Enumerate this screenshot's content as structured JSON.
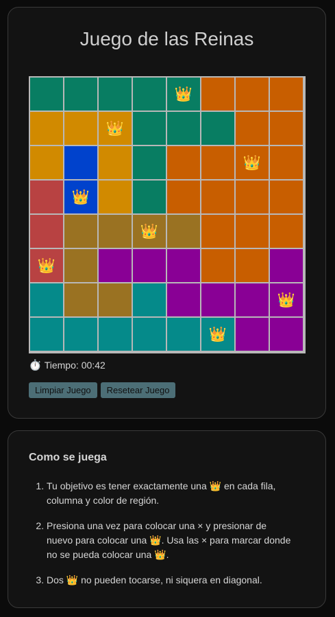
{
  "game": {
    "title": "Juego de las Reinas",
    "timer_icon": "⏱️",
    "timer_label": "Tiempo:",
    "timer_value": "00:42",
    "clear_button": "Limpiar Juego",
    "reset_button": "Resetear Juego"
  },
  "colors": {
    "G": "#087d62",
    "O": "#c85e00",
    "Y": "#d18a00",
    "B": "#0042cc",
    "R": "#b84242",
    "K": "#9a7222",
    "P": "#890095",
    "T": "#058a8a"
  },
  "board": {
    "queen_symbol": "👑",
    "rows": [
      "GGGGGOOO",
      "YYYGGGOO",
      "YBYGOOOO",
      "RBYGOOOO",
      "RKKKKOOO",
      "RKPPPOOP",
      "TKKTPPPP",
      "TTTTTTPP"
    ],
    "queens": [
      [
        0,
        4
      ],
      [
        1,
        2
      ],
      [
        2,
        6
      ],
      [
        3,
        1
      ],
      [
        4,
        3
      ],
      [
        5,
        0
      ],
      [
        6,
        7
      ],
      [
        7,
        5
      ]
    ]
  },
  "rules": {
    "title": "Como se juega",
    "items": [
      "Tu objetivo es tener exactamente una 👑 en cada fila, columna y color de región.",
      "Presiona una vez para colocar una × y presionar de nuevo para colocar una 👑. Usa las × para marcar donde no se pueda colocar una 👑.",
      "Dos 👑 no pueden tocarse, ni siquera en diagonal."
    ]
  }
}
